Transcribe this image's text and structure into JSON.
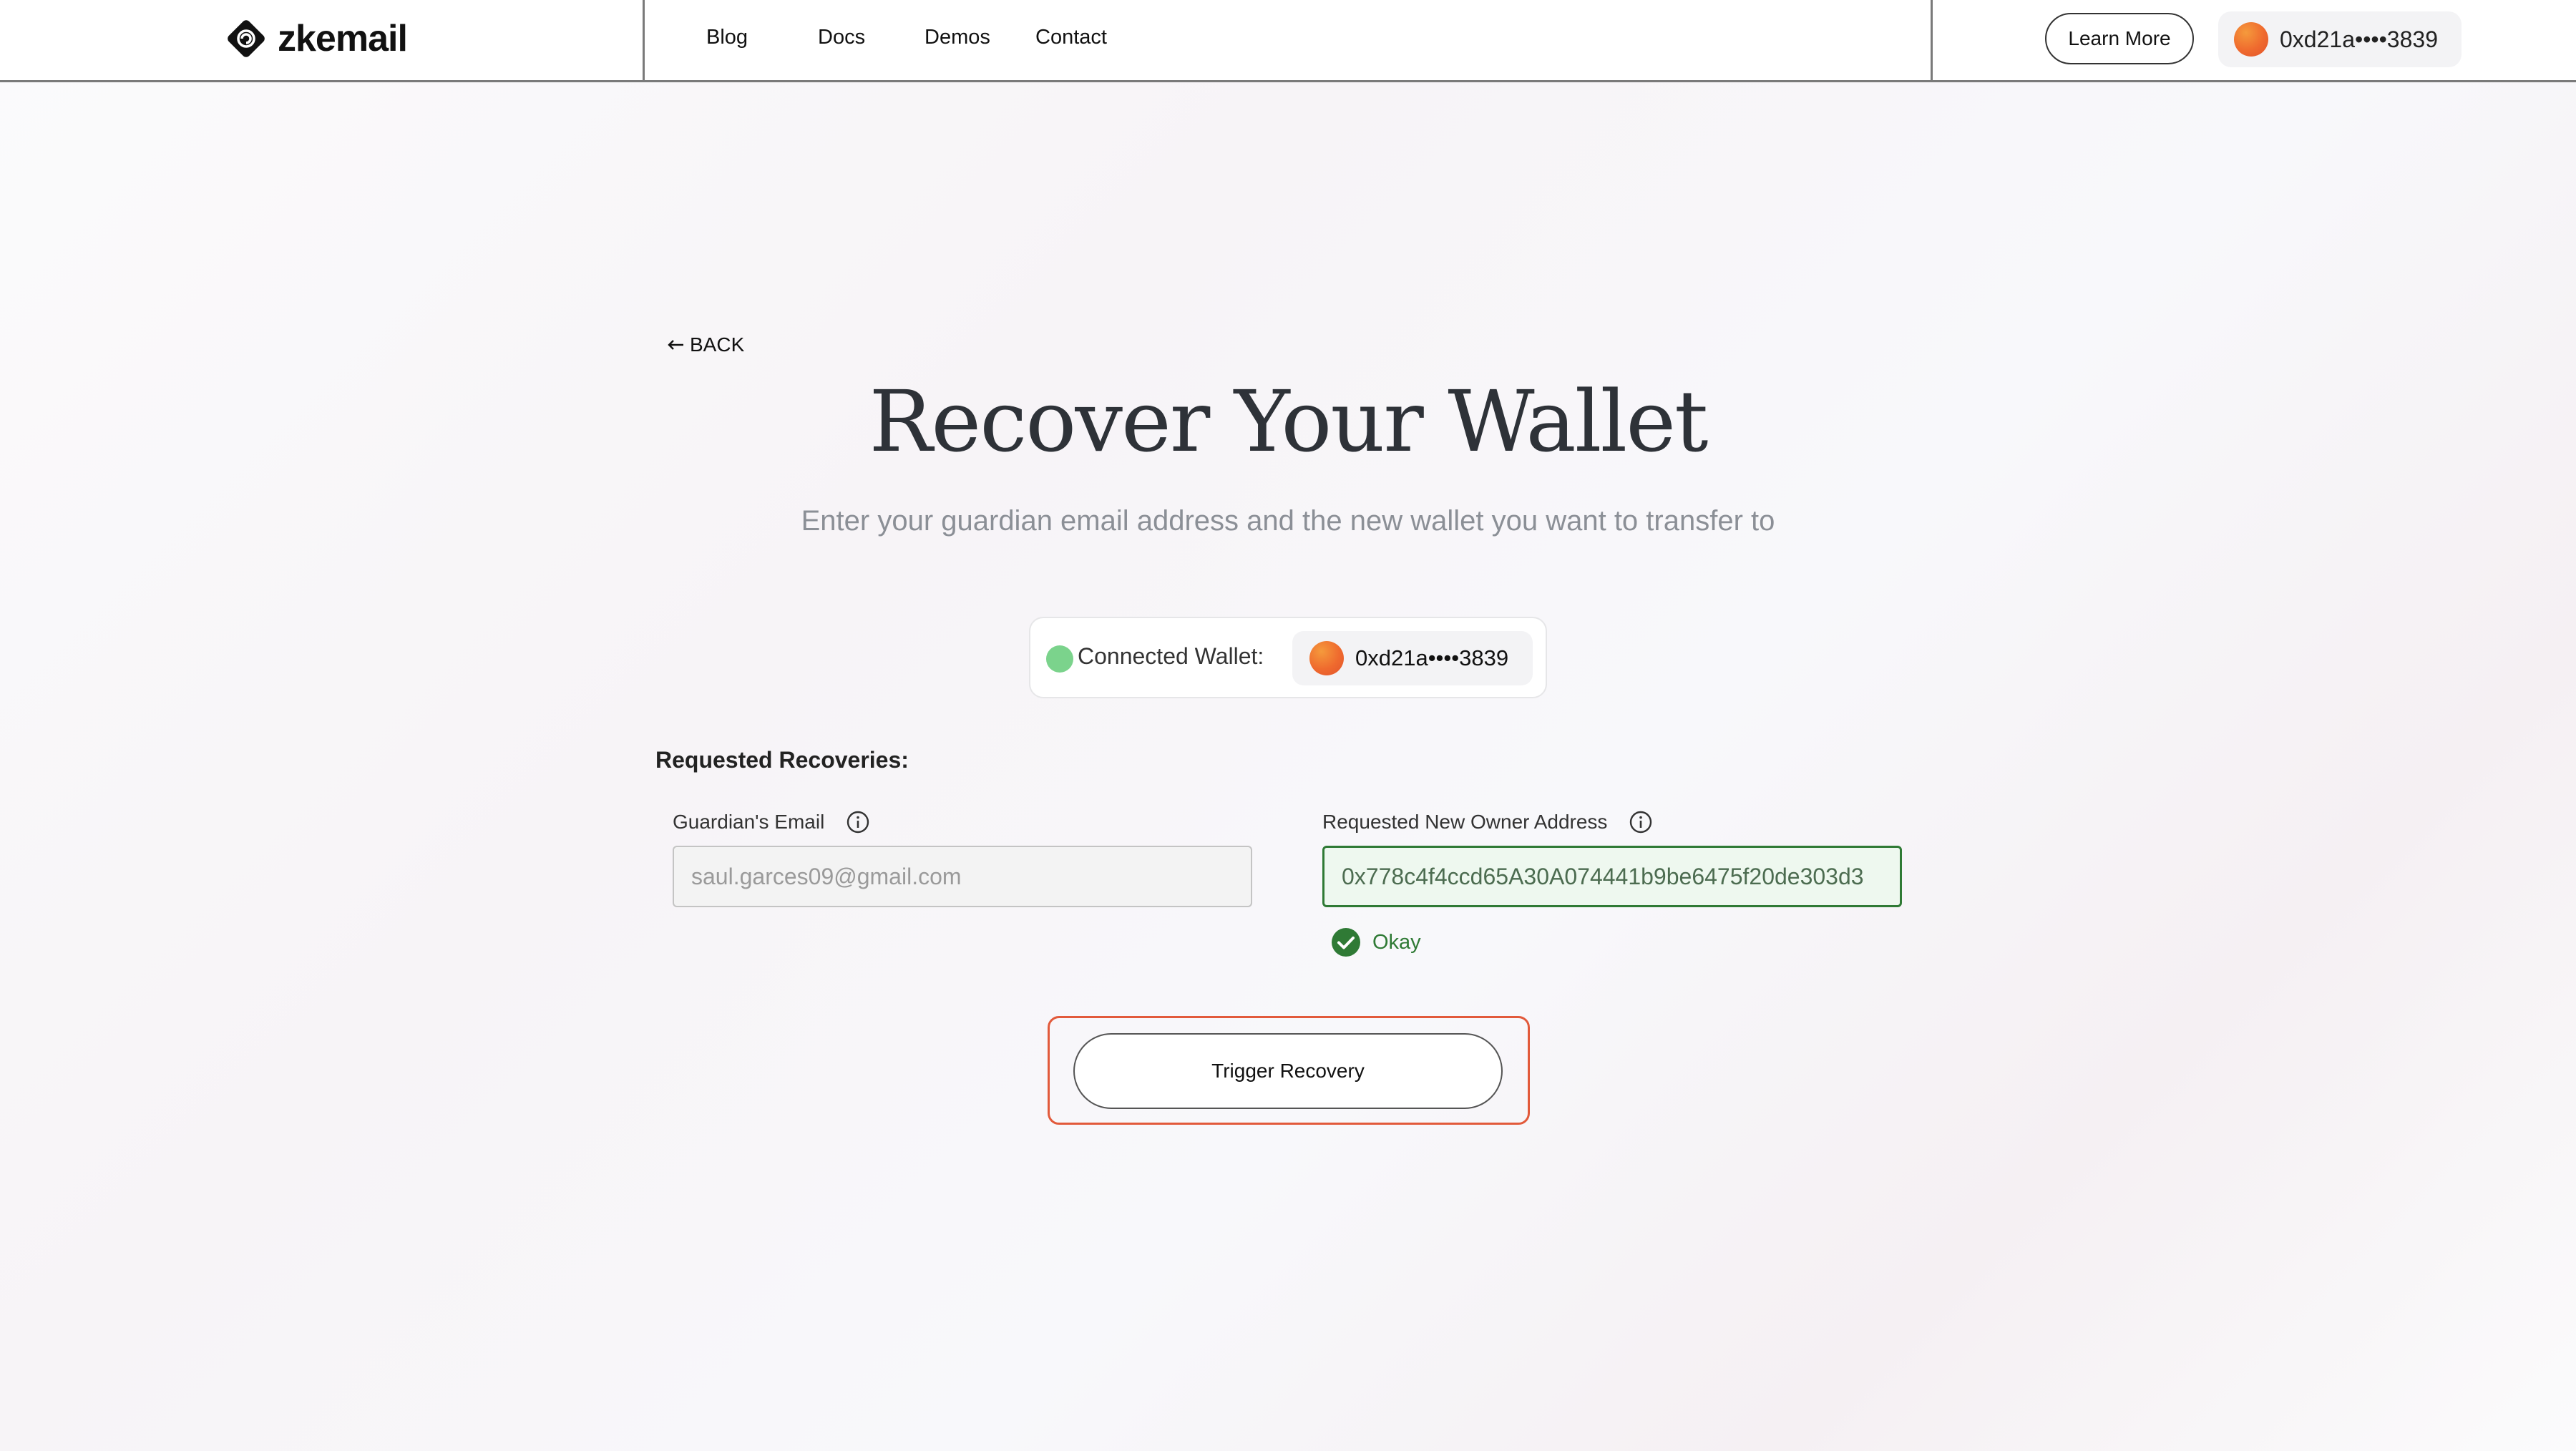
{
  "header": {
    "brand": "zkemail",
    "nav": [
      {
        "label": "Blog"
      },
      {
        "label": "Docs"
      },
      {
        "label": "Demos"
      },
      {
        "label": "Contact"
      }
    ],
    "learn_more_label": "Learn More",
    "wallet_address": "0xd21a••••3839"
  },
  "main": {
    "back_label": "BACK",
    "title": "Recover Your Wallet",
    "subtitle": "Enter your guardian email address and the new wallet you want to transfer to",
    "connected_wallet": {
      "label": "Connected Wallet:",
      "address": "0xd21a••••3839",
      "status_color": "#7bd38c"
    },
    "requested_recoveries_label": "Requested Recoveries:",
    "guardian_email": {
      "label": "Guardian's Email",
      "value": "saul.garces09@gmail.com"
    },
    "new_owner_address": {
      "label": "Requested New Owner Address",
      "value": "0x778c4f4ccd65A30A074441b9be6475f20de303d3",
      "validation": "Okay"
    },
    "trigger_button_label": "Trigger Recovery"
  },
  "colors": {
    "accent_highlight": "#e25a3b",
    "valid_green": "#2f7a35",
    "avatar_orange": "#ef6a2e"
  },
  "icons": [
    "zkemail-logo-icon",
    "arrow-left-icon",
    "info-icon",
    "check-circle-icon"
  ]
}
